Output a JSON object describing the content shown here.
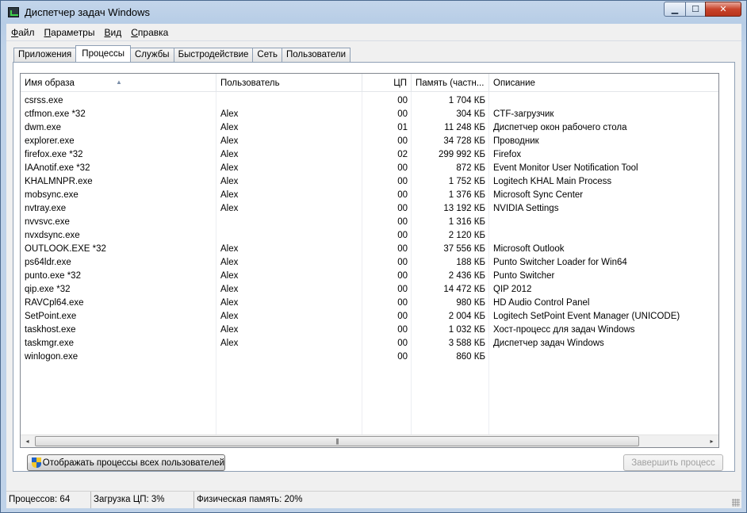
{
  "window": {
    "title": "Диспетчер задач Windows",
    "controls": {
      "minimize": "▁",
      "maximize": "☐",
      "close": "✕"
    }
  },
  "menu": [
    {
      "label": "Ф",
      "rest": "айл"
    },
    {
      "label": "П",
      "rest": "араметры"
    },
    {
      "label": "В",
      "rest": "ид"
    },
    {
      "label": "С",
      "rest": "правка"
    }
  ],
  "tabs": [
    "Приложения",
    "Процессы",
    "Службы",
    "Быстродействие",
    "Сеть",
    "Пользователи"
  ],
  "active_tab": "Процессы",
  "columns": {
    "image": "Имя образа",
    "user": "Пользователь",
    "cpu": "ЦП",
    "memory": "Память (частн...",
    "description": "Описание"
  },
  "processes": [
    {
      "image": "csrss.exe",
      "user": "",
      "cpu": "00",
      "memory": "1 704 КБ",
      "description": ""
    },
    {
      "image": "ctfmon.exe *32",
      "user": "Alex",
      "cpu": "00",
      "memory": "304 КБ",
      "description": "CTF-загрузчик"
    },
    {
      "image": "dwm.exe",
      "user": "Alex",
      "cpu": "01",
      "memory": "11 248 КБ",
      "description": "Диспетчер окон рабочего стола"
    },
    {
      "image": "explorer.exe",
      "user": "Alex",
      "cpu": "00",
      "memory": "34 728 КБ",
      "description": "Проводник"
    },
    {
      "image": "firefox.exe *32",
      "user": "Alex",
      "cpu": "02",
      "memory": "299 992 КБ",
      "description": "Firefox"
    },
    {
      "image": "IAAnotif.exe *32",
      "user": "Alex",
      "cpu": "00",
      "memory": "872 КБ",
      "description": "Event Monitor User Notification Tool"
    },
    {
      "image": "KHALMNPR.exe",
      "user": "Alex",
      "cpu": "00",
      "memory": "1 752 КБ",
      "description": "Logitech KHAL Main Process"
    },
    {
      "image": "mobsync.exe",
      "user": "Alex",
      "cpu": "00",
      "memory": "1 376 КБ",
      "description": "Microsoft Sync Center"
    },
    {
      "image": "nvtray.exe",
      "user": "Alex",
      "cpu": "00",
      "memory": "13 192 КБ",
      "description": "NVIDIA Settings"
    },
    {
      "image": "nvvsvc.exe",
      "user": "",
      "cpu": "00",
      "memory": "1 316 КБ",
      "description": ""
    },
    {
      "image": "nvxdsync.exe",
      "user": "",
      "cpu": "00",
      "memory": "2 120 КБ",
      "description": ""
    },
    {
      "image": "OUTLOOK.EXE *32",
      "user": "Alex",
      "cpu": "00",
      "memory": "37 556 КБ",
      "description": "Microsoft Outlook"
    },
    {
      "image": "ps64ldr.exe",
      "user": "Alex",
      "cpu": "00",
      "memory": "188 КБ",
      "description": "Punto Switcher Loader for Win64"
    },
    {
      "image": "punto.exe *32",
      "user": "Alex",
      "cpu": "00",
      "memory": "2 436 КБ",
      "description": "Punto Switcher"
    },
    {
      "image": "qip.exe *32",
      "user": "Alex",
      "cpu": "00",
      "memory": "14 472 КБ",
      "description": "QIP 2012"
    },
    {
      "image": "RAVCpl64.exe",
      "user": "Alex",
      "cpu": "00",
      "memory": "980 КБ",
      "description": "HD Audio Control Panel"
    },
    {
      "image": "SetPoint.exe",
      "user": "Alex",
      "cpu": "00",
      "memory": "2 004 КБ",
      "description": "Logitech SetPoint Event Manager (UNICODE)"
    },
    {
      "image": "taskhost.exe",
      "user": "Alex",
      "cpu": "00",
      "memory": "1 032 КБ",
      "description": "Хост-процесс для задач Windows"
    },
    {
      "image": "taskmgr.exe",
      "user": "Alex",
      "cpu": "00",
      "memory": "3 588 КБ",
      "description": "Диспетчер задач Windows"
    },
    {
      "image": "winlogon.exe",
      "user": "",
      "cpu": "00",
      "memory": "860 КБ",
      "description": ""
    }
  ],
  "buttons": {
    "show_all": "Отображать процессы всех пользователей",
    "end_process": "Завершить процесс"
  },
  "status": {
    "processes": "Процессов: 64",
    "cpu": "Загрузка ЦП: 3%",
    "memory": "Физическая память: 20%"
  },
  "scrollbar": {
    "left": "◂",
    "right": "▸",
    "grip": "|||"
  },
  "icons": {
    "app": "task-manager-icon",
    "shield": "uac-shield-icon"
  }
}
